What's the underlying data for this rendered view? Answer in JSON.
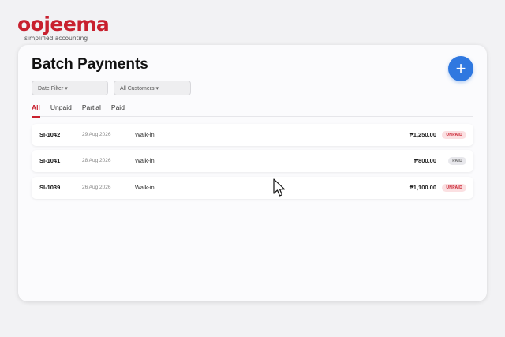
{
  "brand": {
    "name": "oojeema",
    "tagline": "simplified accounting",
    "color": "#c8202e"
  },
  "page": {
    "title": "Batch Payments",
    "add_button_label": "+"
  },
  "filters": {
    "date_label": "Date Filter ▾",
    "customer_label": "All Customers ▾"
  },
  "tabs": [
    {
      "label": "All",
      "active": true
    },
    {
      "label": "Unpaid",
      "active": false
    },
    {
      "label": "Partial",
      "active": false
    },
    {
      "label": "Paid",
      "active": false
    }
  ],
  "invoices": [
    {
      "id": "SI-1042",
      "date": "29 Aug 2026",
      "customer": "Walk-in",
      "amount": "₱1,250.00",
      "status": "UNPAID"
    },
    {
      "id": "SI-1041",
      "date": "28 Aug 2026",
      "customer": "Walk-in",
      "amount": "₱800.00",
      "status": "PAID"
    },
    {
      "id": "SI-1039",
      "date": "26 Aug 2026",
      "customer": "Walk-in",
      "amount": "₱1,100.00",
      "status": "UNPAID"
    }
  ],
  "colors": {
    "accent": "#2f78e0",
    "unpaid": "#c8202e",
    "background": "#f2f2f4"
  },
  "icons": {
    "add": "plus-icon",
    "cursor": "mouse-pointer-icon"
  }
}
